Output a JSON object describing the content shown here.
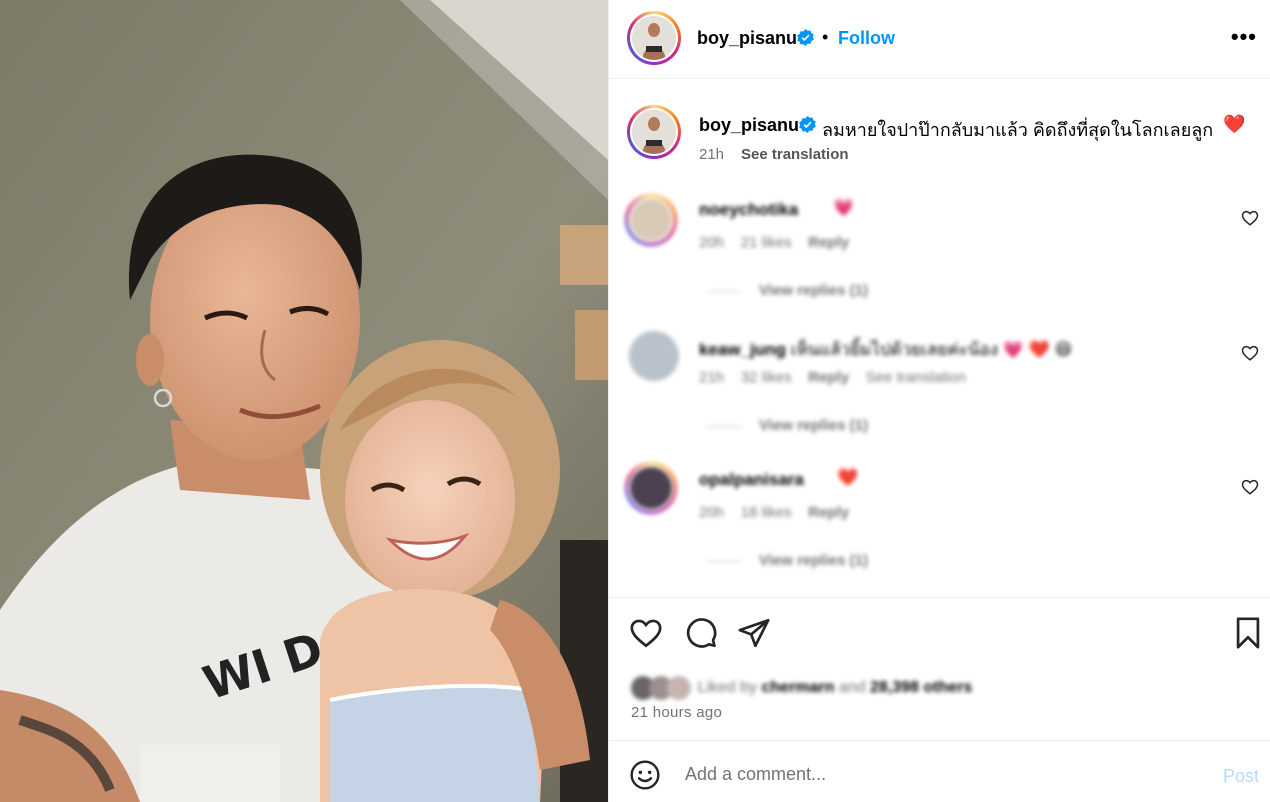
{
  "post": {
    "username": "boy_pisanu",
    "follow_label": "Follow",
    "dot": "•",
    "more_label": "•••",
    "verified_icon": "verified-badge-icon",
    "caption": "ลมหายใจปาป๊ากลับมาแล้ว คิดถึงที่สุดในโลกเลยลูก",
    "caption_emoji": "❤️",
    "caption_time": "21h",
    "see_translation": "See translation",
    "colors": {
      "accent": "#0095f6",
      "secondary_text": "#737373",
      "heart": "#ff3040"
    }
  },
  "comments": [
    {
      "username": "noeychotika",
      "emoji": "💗",
      "time": "20h",
      "likes": "21 likes",
      "reply": "Reply",
      "translation": "",
      "view_replies": "View replies (1)"
    },
    {
      "username": "keaw_jung",
      "text": "เห็นแล้วยิ้มไปด้วยเลยค่ะน้อง",
      "emoji": "💗 ❤️ 😆",
      "time": "21h",
      "likes": "32 likes",
      "reply": "Reply",
      "translation": "See translation",
      "view_replies": "View replies (1)"
    },
    {
      "username": "opalpanisara",
      "emoji": "❤️",
      "time": "20h",
      "likes": "18 likes",
      "reply": "Reply",
      "translation": "",
      "view_replies": "View replies (1)"
    }
  ],
  "actions": {
    "like_icon": "heart-icon",
    "comment_icon": "comment-bubble-icon",
    "share_icon": "paper-plane-icon",
    "save_icon": "bookmark-icon"
  },
  "likes_line": {
    "prefix": "Liked by",
    "user": "chermarn",
    "joiner": "and",
    "others": "28,398 others"
  },
  "timestamp": "21 hours ago",
  "comment_box": {
    "placeholder": "Add a comment...",
    "post_label": "Post",
    "emoji_icon": "smiley-icon"
  }
}
